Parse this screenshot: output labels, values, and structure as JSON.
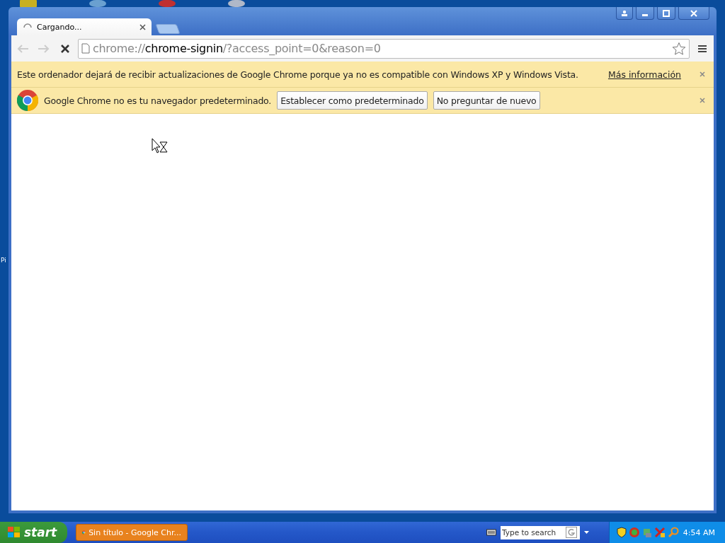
{
  "desktop": {
    "label": "Pi"
  },
  "browser": {
    "tabs": [
      {
        "title": "Cargando...",
        "selected": true,
        "loading": true
      }
    ],
    "nav": {
      "back_disabled": true,
      "forward_disabled": true
    },
    "address": [
      {
        "kind": "scheme",
        "text": "chrome://"
      },
      {
        "kind": "host",
        "text": "chrome-signin"
      },
      {
        "kind": "path",
        "text": "/?access_point=0&reason=0"
      }
    ],
    "infobars": [
      {
        "kind": "notice",
        "text": "Este ordenador dejará de recibir actualizaciones de Google Chrome porque ya no es compatible con Windows XP y Windows Vista.",
        "link": "Más información"
      },
      {
        "kind": "default",
        "text": "Google Chrome no es tu navegador predeterminado.",
        "buttons": [
          "Establecer como predeterminado",
          "No preguntar de nuevo"
        ]
      }
    ]
  },
  "taskbar": {
    "start": "start",
    "tasks": [
      {
        "label": "Sin título - Google Chr...",
        "selected": true
      }
    ],
    "search": {
      "placeholder": "Type to search"
    },
    "clock": "4:54 AM"
  }
}
